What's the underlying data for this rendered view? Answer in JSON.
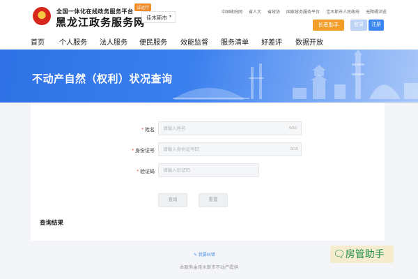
{
  "header": {
    "site_subtitle": "全国一体化在线政务服务平台",
    "site_title": "黑龙江政务服务网",
    "badge": "试运行",
    "city": "佳木斯市",
    "top_links": [
      "中国政府网",
      "省人大",
      "省政协",
      "国家政务服务平台",
      "佳木斯市人民政府",
      "无障碍浏览"
    ],
    "elder_button": "长者助手",
    "login_button": "登录",
    "register_button": "注册"
  },
  "nav": {
    "items": [
      "首页",
      "个人服务",
      "法人服务",
      "便民服务",
      "效能监督",
      "服务清单",
      "好差评",
      "数据开放"
    ]
  },
  "banner": {
    "title": "不动产自然（权利）状况查询"
  },
  "form": {
    "name_label": "姓名",
    "name_placeholder": "请输入姓名",
    "name_count": "0/50",
    "id_label": "身份证号",
    "id_placeholder": "请输入身份证号码",
    "id_count": "0/18",
    "captcha_label": "验证码",
    "captcha_placeholder": "请输入验证码",
    "query_button": "查询",
    "reset_button": "重置",
    "result_title": "查询结果"
  },
  "footer": {
    "feedback_link": "我要纠错",
    "provider": "本服务由佳木斯市不动产提供"
  },
  "watermark": {
    "text": "房管助手"
  },
  "colors": {
    "primary": "#3b86f2",
    "elder": "#f29d27",
    "banner": "#2f72e5",
    "required": "#e0352a"
  }
}
